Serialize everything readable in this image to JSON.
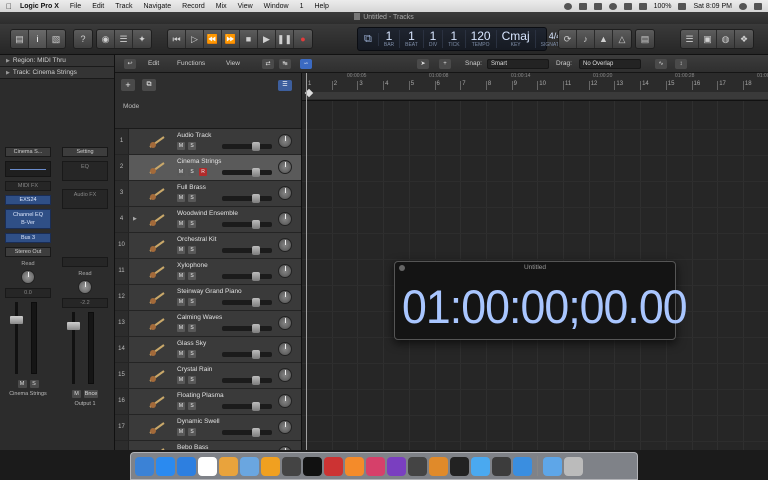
{
  "menubar": {
    "items": [
      "Logic Pro X",
      "File",
      "Edit",
      "Track",
      "Navigate",
      "Record",
      "Mix",
      "View",
      "Window",
      "1",
      "Help"
    ],
    "battery": "100%",
    "clock": "Sat 8:09 PM"
  },
  "window": {
    "title": "Untitled - Tracks"
  },
  "control_bar": {
    "left_icons": [
      "library-icon",
      "info-icon",
      "toolbar-icon",
      "help-icon",
      "smart-controls-icon",
      "mixer-icon",
      "editors-icon"
    ],
    "transport_icons": [
      "go-to-start-icon",
      "play-from-start-icon",
      "rewind-icon",
      "fast-forward-icon",
      "stop-icon",
      "play-icon",
      "pause-icon",
      "record-icon"
    ],
    "lcd": {
      "bar": "1",
      "bar_label": "BAR",
      "beat": "1",
      "beat_label": "BEAT",
      "div": "1",
      "div_label": "DIV",
      "tick": "1",
      "tick_label": "TICK",
      "tempo": "120",
      "tempo_label": "TEMPO",
      "key": "Cmaj",
      "key_label": "KEY",
      "signature": "4/4",
      "signature_label": "SIGNATURE"
    },
    "right_icons": [
      "cycle-icon",
      "tuner-icon",
      "count-in-icon",
      "metronome-icon",
      "notepad-icon",
      "list-editors-icon",
      "browsers-icon",
      "loops-icon"
    ]
  },
  "inspector": {
    "region": "Region: MIDI Thru",
    "track": "Track: Cinema Strings",
    "strip1": {
      "setting": "Cinema S...",
      "midi_fx": "MIDI FX",
      "instrument": "EXS24",
      "insert": "Channel EQ",
      "insert2": "B-Ver",
      "send": "Bus 3",
      "output": "Stereo Out",
      "automation": "Read",
      "pan_value": "0.0",
      "name": "Cinema Strings"
    },
    "strip2": {
      "setting": "Setting",
      "eq": "EQ",
      "audio_fx": "Audio FX",
      "group": "Read",
      "pan_value": "-2.2",
      "bounce": "Bnce",
      "name": "Output 1"
    }
  },
  "tracks_header": {
    "edit": "Edit",
    "functions": "Functions",
    "view": "View",
    "snap_label": "Snap:",
    "snap_value": "Smart",
    "drag_label": "Drag:",
    "drag_value": "No Overlap",
    "mode": "Mode"
  },
  "ruler": {
    "bars": [
      "1",
      "2",
      "3",
      "4",
      "5",
      "6",
      "7",
      "8",
      "9",
      "10",
      "11",
      "12",
      "13",
      "14",
      "15",
      "16",
      "17",
      "18"
    ],
    "times": [
      "",
      "00:00:05",
      "",
      "01:00:08",
      "",
      "01:00:14",
      "",
      "01:00:20",
      "",
      "01:00:28",
      "",
      "01:00:33"
    ]
  },
  "tracks": [
    {
      "num": "1",
      "name": "Audio Track",
      "icon": "waveform-icon",
      "selected": false,
      "record": false
    },
    {
      "num": "2",
      "name": "Cinema Strings",
      "icon": "strings-icon",
      "selected": true,
      "record": true
    },
    {
      "num": "3",
      "name": "Full Brass",
      "icon": "brass-icon",
      "selected": false,
      "record": false
    },
    {
      "num": "4",
      "name": "Woodwind Ensemble",
      "icon": "woodwind-icon",
      "selected": false,
      "record": false
    },
    {
      "num": "10",
      "name": "Orchestral Kit",
      "icon": "drum-kit-icon",
      "selected": false,
      "record": false
    },
    {
      "num": "11",
      "name": "Xylophone",
      "icon": "xylophone-icon",
      "selected": false,
      "record": false
    },
    {
      "num": "12",
      "name": "Steinway Grand Piano",
      "icon": "piano-icon",
      "selected": false,
      "record": false
    },
    {
      "num": "13",
      "name": "Calming Waves",
      "icon": "synth-icon",
      "selected": false,
      "record": false
    },
    {
      "num": "14",
      "name": "Glass Sky",
      "icon": "synth-icon",
      "selected": false,
      "record": false
    },
    {
      "num": "15",
      "name": "Crystal Rain",
      "icon": "synth-icon",
      "selected": false,
      "record": false
    },
    {
      "num": "16",
      "name": "Floating Plasma",
      "icon": "synth-icon",
      "selected": false,
      "record": false
    },
    {
      "num": "17",
      "name": "Dynamic Swell",
      "icon": "synth-icon",
      "selected": false,
      "record": false
    },
    {
      "num": "",
      "name": "Bebo Bass",
      "icon": "bass-icon",
      "selected": false,
      "record": false
    }
  ],
  "timecode_window": {
    "title": "Untitled",
    "value": "01:00:00;00.00"
  },
  "dock": {
    "apps": [
      "finder",
      "app-store",
      "safari",
      "calendar",
      "photos",
      "preview",
      "garageband",
      "logic",
      "live",
      "final-cut",
      "photos-app",
      "itunes",
      "motion",
      "logic-pro",
      "books",
      "voice-over",
      "messages",
      "system-info",
      "documents",
      "downloads",
      "trash"
    ]
  }
}
